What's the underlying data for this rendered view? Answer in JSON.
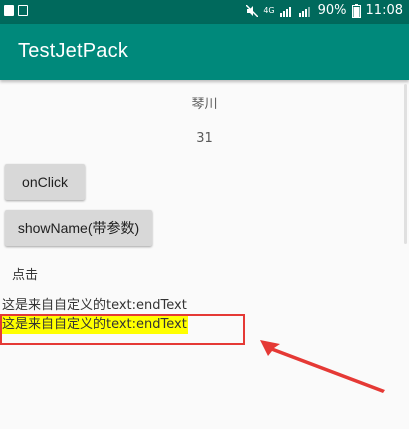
{
  "status_bar": {
    "network": "4G",
    "battery": "90%",
    "time": "11:08"
  },
  "app_bar": {
    "title": "TestJetPack"
  },
  "content": {
    "name": "琴川",
    "age": "31",
    "on_click_button": "onClick",
    "show_name_button": "showName(带参数)",
    "click_label": "点击",
    "custom_text_1": "这是来自自定义的text:endText",
    "custom_text_2": "这是来自自定义的text:endText"
  },
  "colors": {
    "status_bar": "#00695c",
    "app_bar": "#00897b",
    "highlight": "#ffff00",
    "annotation": "#e53935"
  }
}
